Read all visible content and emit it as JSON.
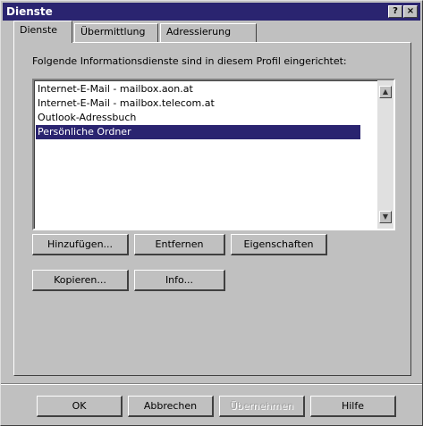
{
  "window": {
    "title": "Dienste"
  },
  "titlebar": {
    "help_glyph": "?",
    "close_glyph": "×"
  },
  "tabs": [
    {
      "label": "Dienste",
      "active": true
    },
    {
      "label": "Übermittlung",
      "active": false
    },
    {
      "label": "Adressierung",
      "active": false
    }
  ],
  "services": {
    "caption": "Folgende Informationsdienste sind in diesem Profil eingerichtet:",
    "items": [
      "Internet-E-Mail - mailbox.aon.at",
      "Internet-E-Mail - mailbox.telecom.at",
      "Outlook-Adressbuch",
      "Persönliche Ordner"
    ],
    "selected_index": 3
  },
  "scrollbar": {
    "up_glyph": "▲",
    "down_glyph": "▼"
  },
  "actions": {
    "add": "Hinzufügen...",
    "remove": "Entfernen",
    "properties": "Eigenschaften",
    "copy": "Kopieren...",
    "info": "Info..."
  },
  "footer": {
    "ok": "OK",
    "cancel": "Abbrechen",
    "apply": "Übernehmen",
    "help": "Hilfe"
  }
}
